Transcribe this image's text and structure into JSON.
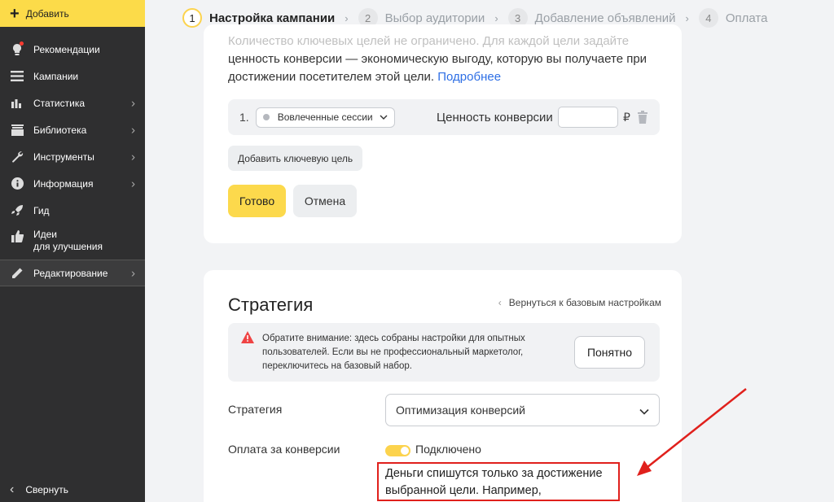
{
  "sidebar": {
    "add_label": "Добавить",
    "items": [
      {
        "label": "Рекомендации",
        "icon": "bulb-icon",
        "chevron": false
      },
      {
        "label": "Кампании",
        "icon": "menu-icon",
        "chevron": false
      },
      {
        "label": "Статистика",
        "icon": "chart-icon",
        "chevron": true
      },
      {
        "label": "Библиотека",
        "icon": "library-icon",
        "chevron": true
      },
      {
        "label": "Инструменты",
        "icon": "wrench-icon",
        "chevron": true
      },
      {
        "label": "Информация",
        "icon": "info-icon",
        "chevron": true
      },
      {
        "label": "Гид",
        "icon": "rocket-icon",
        "chevron": false
      },
      {
        "label_line1": "Идеи",
        "label_line2": "для улучшения",
        "icon": "thumbs-up-icon",
        "chevron": false
      },
      {
        "label": "Редактирование",
        "icon": "pencil-icon",
        "chevron": true
      }
    ],
    "collapse_label": "Свернуть"
  },
  "stepper": {
    "steps": [
      {
        "num": "1",
        "label": "Настройка кампании"
      },
      {
        "num": "2",
        "label": "Выбор аудитории"
      },
      {
        "num": "3",
        "label": "Добавление объявлений"
      },
      {
        "num": "4",
        "label": "Оплата"
      }
    ]
  },
  "goals_card": {
    "text_faded": "Количество ключевых целей не ограничено. Для каждой цели задайте",
    "text_main": "ценность конверсии — экономическую выгоду, которую вы получаете при достижении посетителем этой цели.",
    "link": "Подробнее",
    "goal_num": "1.",
    "goal_value": "Вовлеченные сессии",
    "conversion_label": "Ценность конверсии",
    "currency": "₽",
    "add_goal_label": "Добавить ключевую цель",
    "done_label": "Готово",
    "cancel_label": "Отмена"
  },
  "strategy_card": {
    "title": "Стратегия",
    "back_label": "Вернуться к базовым настройкам",
    "notice_text": "Обратите внимание: здесь собраны настройки для опытных пользователей. Если вы не профессиональный маркетолог, переключитесь на базовый набор.",
    "notice_button": "Понятно",
    "strategy_label": "Стратегия",
    "strategy_value": "Оптимизация конверсий",
    "payment_label": "Оплата за конверсии",
    "payment_status": "Подключено",
    "highlight_text": "Деньги спишутся только за достижение выбранной цели. Например, оформление"
  },
  "colors": {
    "accent_yellow": "#fcd94c",
    "sidebar_bg": "#2f2f30",
    "link_blue": "#2e6fe5",
    "annotation_red": "#e0201c"
  }
}
